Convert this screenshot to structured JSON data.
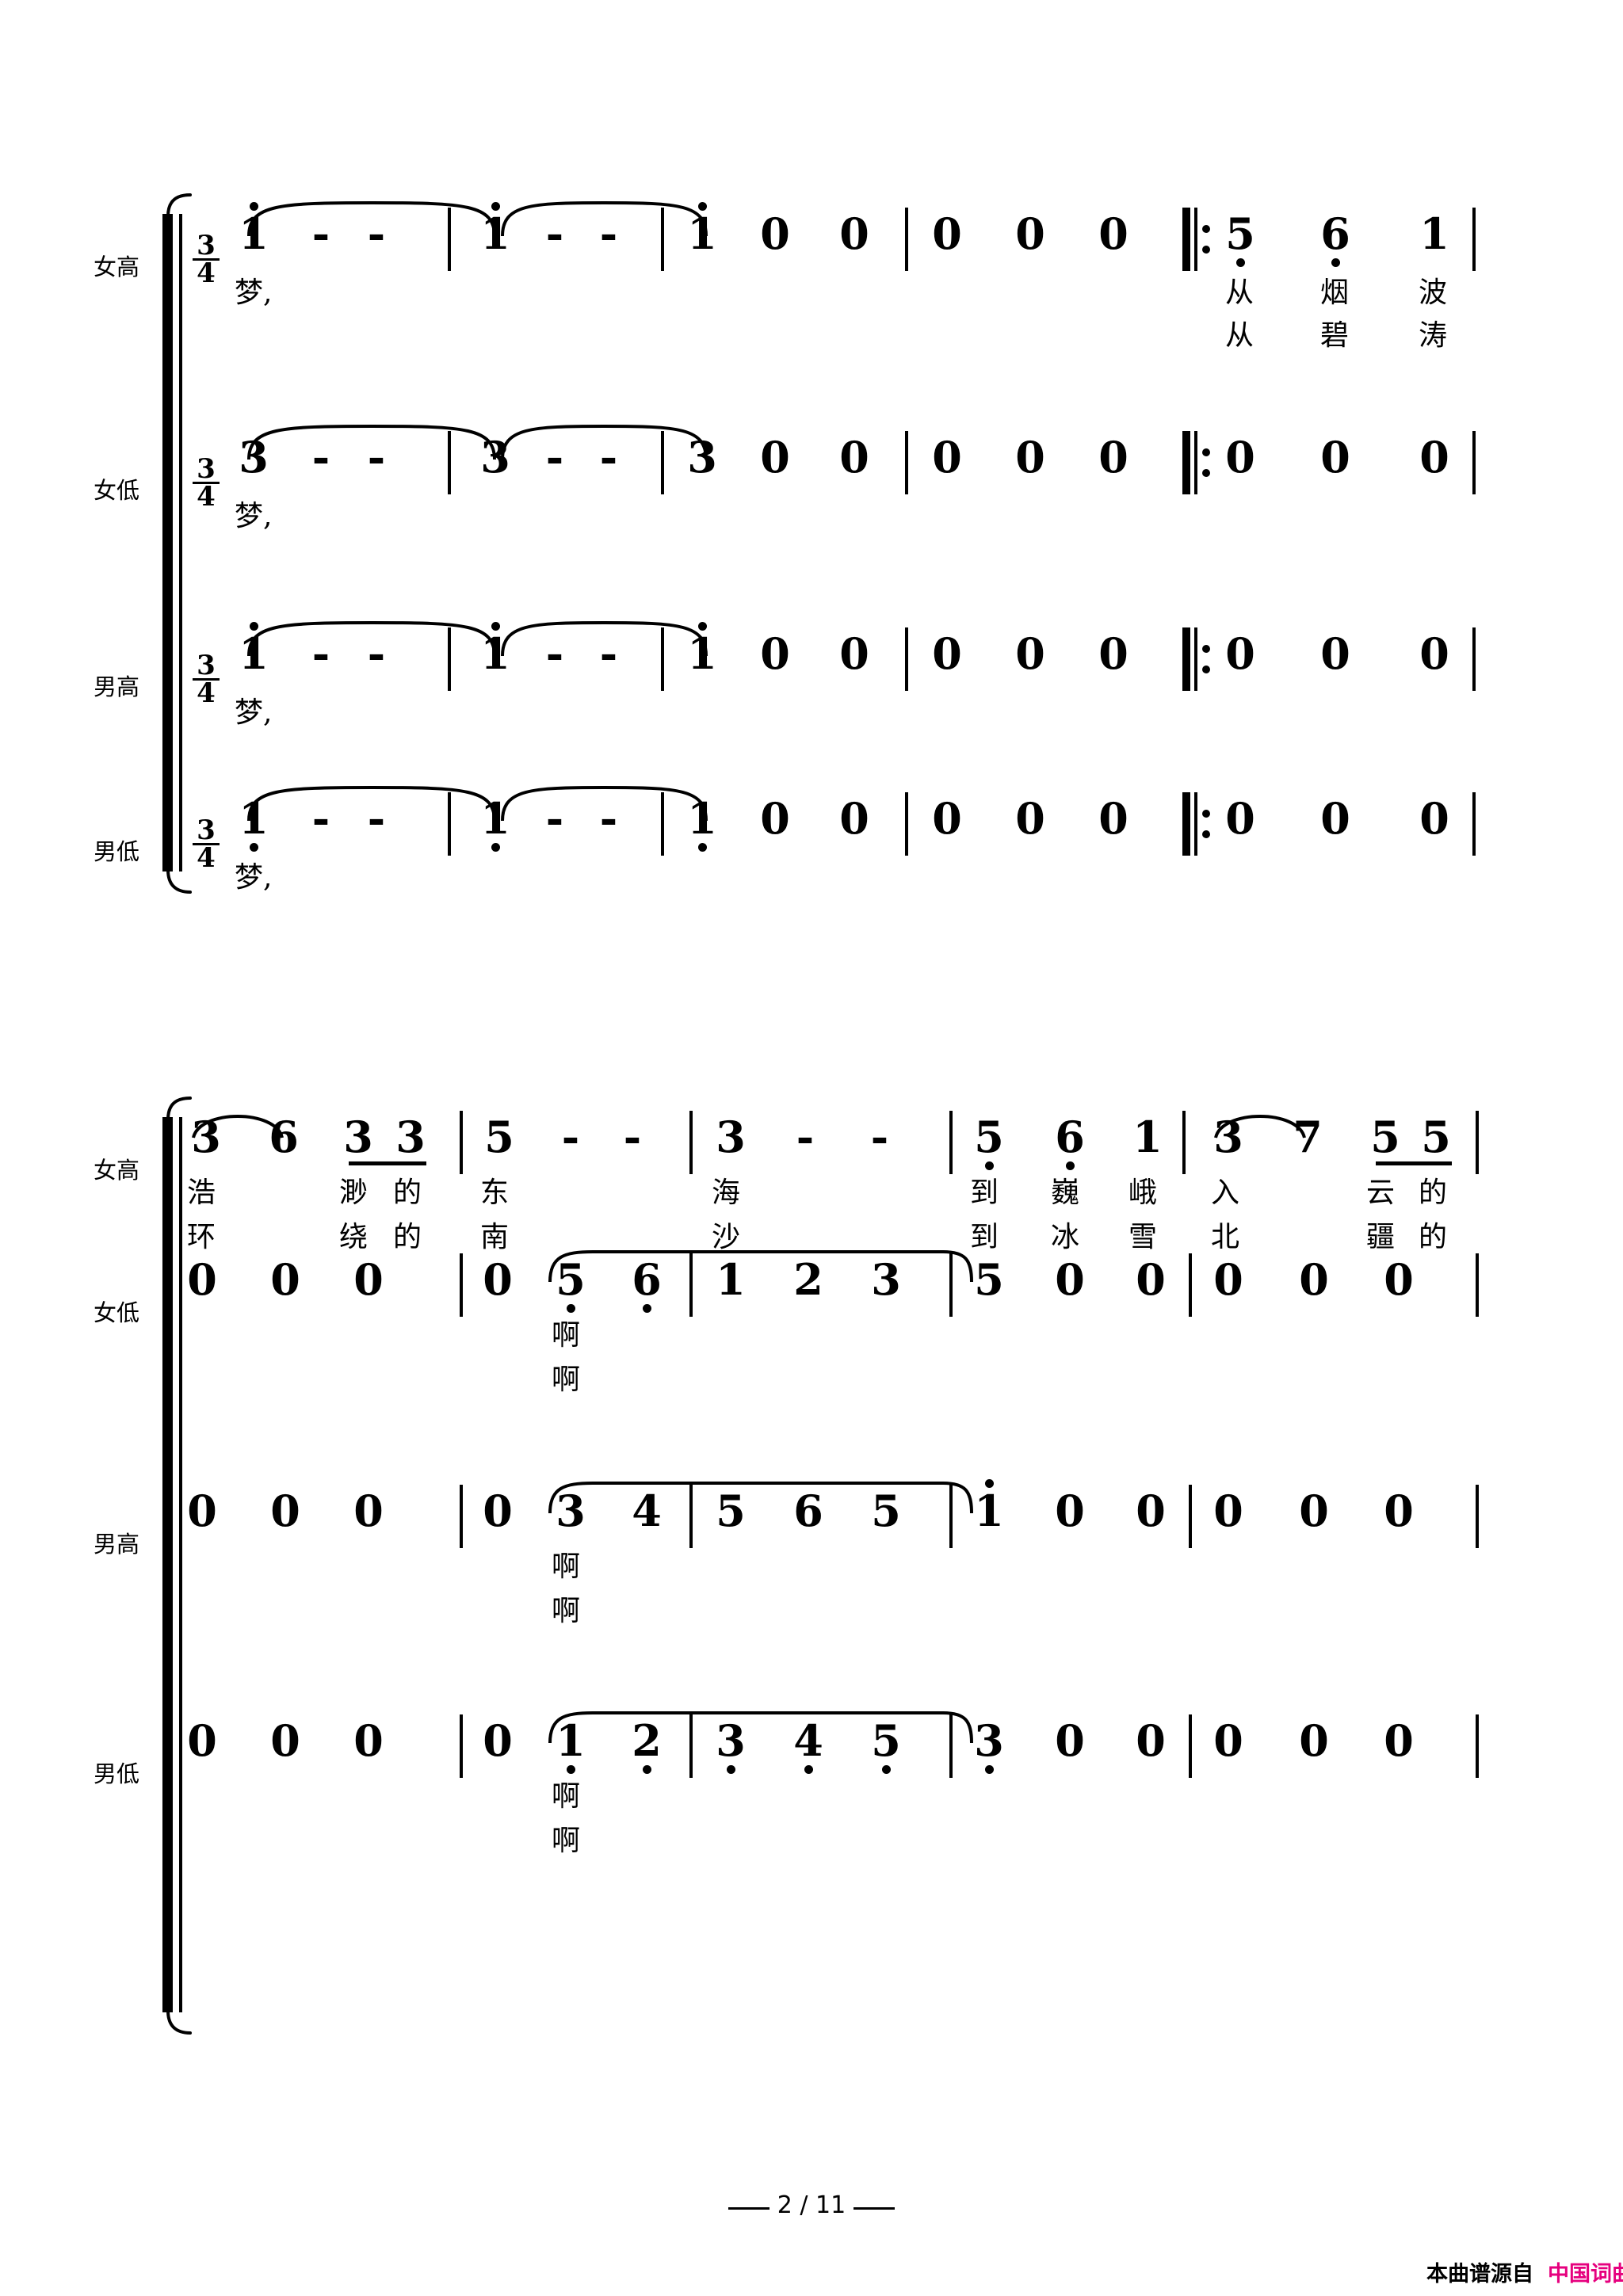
{
  "page": {
    "footer_label": "2 / 11",
    "watermark_prefix": "本曲谱源自",
    "watermark_site": "中国词曲网",
    "watermark_site_color": "#E6007E",
    "background": "#FFFFFF",
    "ink": "#000000"
  },
  "score": {
    "time_signature": {
      "numerator": "3",
      "denominator": "4"
    },
    "part_labels": {
      "soprano": "女高",
      "alto": "女低",
      "tenor": "男高",
      "bass": "男低"
    }
  },
  "systems": [
    {
      "index": 1,
      "staves": [
        {
          "part": "soprano",
          "label": "女高",
          "time_signature": "3/4",
          "measures": [
            {
              "notes": [
                "1̇",
                "-",
                "-"
              ]
            },
            {
              "notes": [
                "1̇",
                "-",
                "-"
              ]
            },
            {
              "notes": [
                "1̇",
                "0",
                "0"
              ]
            },
            {
              "notes": [
                "0",
                "0",
                "0"
              ]
            },
            {
              "repeat_start": true,
              "notes": [
                "5̣",
                "6̣",
                "1"
              ]
            }
          ],
          "note_tokens": [
            "1",
            "-",
            "-",
            "1",
            "-",
            "-",
            "1",
            "0",
            "0",
            "0",
            "0",
            "0",
            "5",
            "6",
            "1"
          ],
          "lyrics_line1": [
            "梦,",
            "",
            "",
            "",
            "",
            "",
            "",
            "",
            "",
            "",
            "",
            "",
            "从",
            "烟",
            "波"
          ],
          "lyrics_line2": [
            "",
            "",
            "",
            "",
            "",
            "",
            "",
            "",
            "",
            "",
            "",
            "",
            "从",
            "碧",
            "涛"
          ]
        },
        {
          "part": "alto",
          "label": "女低",
          "time_signature": "3/4",
          "note_tokens": [
            "3",
            "-",
            "-",
            "3",
            "-",
            "-",
            "3",
            "0",
            "0",
            "0",
            "0",
            "0",
            "0",
            "0",
            "0"
          ],
          "lyrics_line1": [
            "梦,"
          ],
          "lyrics_line2": []
        },
        {
          "part": "tenor",
          "label": "男高",
          "time_signature": "3/4",
          "note_tokens": [
            "1",
            "-",
            "-",
            "1",
            "-",
            "-",
            "1",
            "0",
            "0",
            "0",
            "0",
            "0",
            "0",
            "0",
            "0"
          ],
          "lyrics_line1": [
            "梦,"
          ],
          "lyrics_line2": []
        },
        {
          "part": "bass",
          "label": "男低",
          "time_signature": "3/4",
          "note_tokens": [
            "1",
            "-",
            "-",
            "1",
            "-",
            "-",
            "1",
            "0",
            "0",
            "0",
            "0",
            "0",
            "0",
            "0",
            "0"
          ],
          "lyrics_line1": [
            "梦,"
          ],
          "lyrics_line2": []
        }
      ]
    },
    {
      "index": 2,
      "staves": [
        {
          "part": "soprano",
          "label": "女高",
          "note_tokens": [
            "3",
            "6",
            "3",
            "3",
            "5",
            "-",
            "-",
            "3",
            "-",
            "-",
            "5",
            "6",
            "1",
            "3",
            "7",
            "5",
            "5"
          ],
          "lyrics_line1": [
            "浩",
            "",
            "渺",
            "的",
            "东",
            "",
            "",
            "海",
            "",
            "",
            "到",
            "巍",
            "峨",
            "入",
            "",
            "云",
            "的"
          ],
          "lyrics_line2": [
            "环",
            "",
            "绕",
            "的",
            "南",
            "",
            "",
            "沙",
            "",
            "",
            "到",
            "冰",
            "雪",
            "北",
            "",
            "疆",
            "的"
          ]
        },
        {
          "part": "alto",
          "label": "女低",
          "note_tokens": [
            "0",
            "0",
            "0",
            "0",
            "5",
            "6",
            "1",
            "2",
            "3",
            "5",
            "0",
            "0",
            "0",
            "0",
            "0"
          ],
          "lyrics_line1": [
            "啊"
          ],
          "lyrics_line2": [
            "啊"
          ]
        },
        {
          "part": "tenor",
          "label": "男高",
          "note_tokens": [
            "0",
            "0",
            "0",
            "0",
            "3",
            "4",
            "5",
            "6",
            "5",
            "1",
            "0",
            "0",
            "0",
            "0",
            "0"
          ],
          "lyrics_line1": [
            "啊"
          ],
          "lyrics_line2": [
            "啊"
          ]
        },
        {
          "part": "bass",
          "label": "男低",
          "note_tokens": [
            "0",
            "0",
            "0",
            "0",
            "1",
            "2",
            "3",
            "4",
            "5",
            "3",
            "0",
            "0",
            "0",
            "0",
            "0"
          ],
          "lyrics_line1": [
            "啊"
          ],
          "lyrics_line2": [
            "啊"
          ]
        }
      ]
    }
  ],
  "glyphs": {
    "dash": "-",
    "rest": "0",
    "repeat_sign": "‖:"
  },
  "s1": {
    "sop": {
      "label": "女高",
      "ts_num": "3",
      "ts_den": "4",
      "n": [
        "1",
        "-",
        "-",
        "1",
        "-",
        "-",
        "1",
        "0",
        "0",
        "0",
        "0",
        "0",
        "5",
        "6",
        "1"
      ],
      "ly1": [
        "梦,",
        "从",
        "烟",
        "波"
      ],
      "ly2": [
        "从",
        "碧",
        "涛"
      ]
    },
    "alt": {
      "label": "女低",
      "ts_num": "3",
      "ts_den": "4",
      "n": [
        "3",
        "-",
        "-",
        "3",
        "-",
        "-",
        "3",
        "0",
        "0",
        "0",
        "0",
        "0",
        "0",
        "0",
        "0"
      ],
      "ly1": [
        "梦,"
      ]
    },
    "ten": {
      "label": "男高",
      "ts_num": "3",
      "ts_den": "4",
      "n": [
        "1",
        "-",
        "-",
        "1",
        "-",
        "-",
        "1",
        "0",
        "0",
        "0",
        "0",
        "0",
        "0",
        "0",
        "0"
      ],
      "ly1": [
        "梦,"
      ]
    },
    "bas": {
      "label": "男低",
      "ts_num": "3",
      "ts_den": "4",
      "n": [
        "1",
        "-",
        "-",
        "1",
        "-",
        "-",
        "1",
        "0",
        "0",
        "0",
        "0",
        "0",
        "0",
        "0",
        "0"
      ],
      "ly1": [
        "梦,"
      ]
    }
  },
  "s2": {
    "sop": {
      "label": "女高",
      "n": [
        "3",
        "6",
        "3",
        "3",
        "5",
        "-",
        "-",
        "3",
        "-",
        "-",
        "5",
        "6",
        "1",
        "3",
        "7",
        "5",
        "5"
      ],
      "ly1": [
        "浩",
        "渺",
        "的",
        "东",
        "海",
        "到",
        "巍",
        "峨",
        "入",
        "云",
        "的"
      ],
      "ly2": [
        "环",
        "绕",
        "的",
        "南",
        "沙",
        "到",
        "冰",
        "雪",
        "北",
        "疆",
        "的"
      ]
    },
    "alt": {
      "label": "女低",
      "n": [
        "0",
        "0",
        "0",
        "0",
        "5",
        "6",
        "1",
        "2",
        "3",
        "5",
        "0",
        "0",
        "0",
        "0",
        "0"
      ],
      "ly1": [
        "啊"
      ],
      "ly2": [
        "啊"
      ]
    },
    "ten": {
      "label": "男高",
      "n": [
        "0",
        "0",
        "0",
        "0",
        "3",
        "4",
        "5",
        "6",
        "5",
        "1",
        "0",
        "0",
        "0",
        "0",
        "0"
      ],
      "ly1": [
        "啊"
      ],
      "ly2": [
        "啊"
      ]
    },
    "bas": {
      "label": "男低",
      "n": [
        "0",
        "0",
        "0",
        "0",
        "1",
        "2",
        "3",
        "4",
        "5",
        "3",
        "0",
        "0",
        "0",
        "0",
        "0"
      ],
      "ly1": [
        "啊"
      ],
      "ly2": [
        "啊"
      ]
    }
  }
}
